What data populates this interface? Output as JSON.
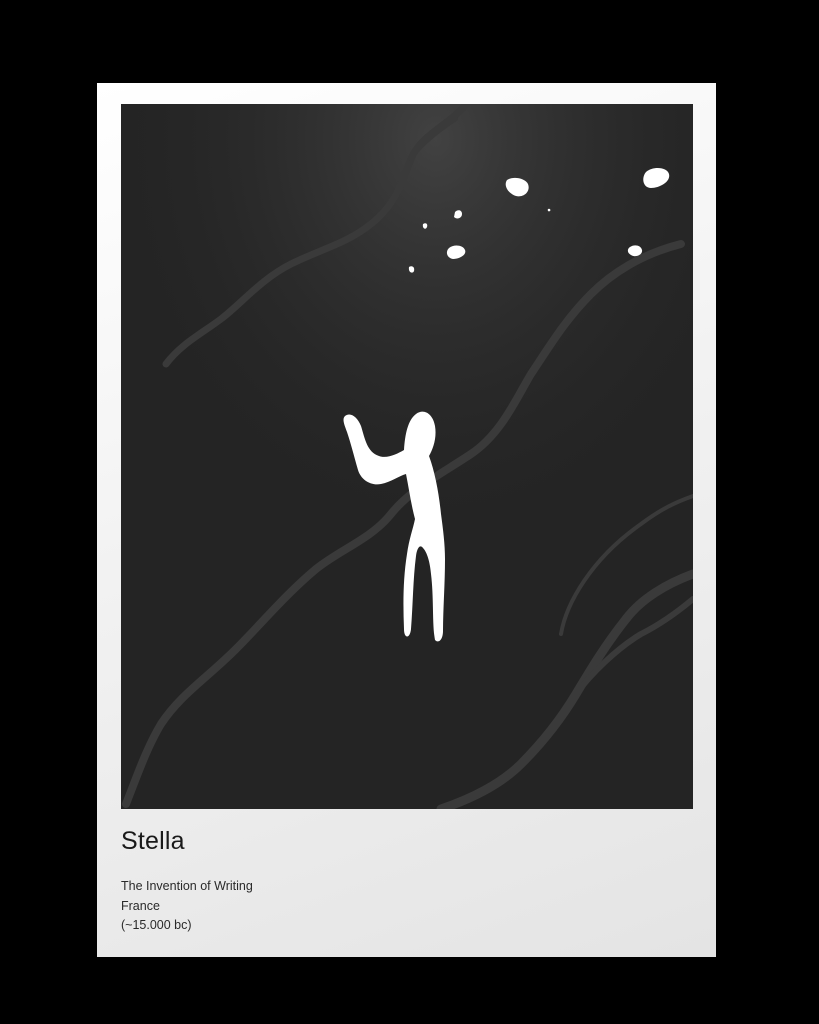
{
  "poster": {
    "title": "Stella",
    "subtitle": "The Invention of Writing",
    "location": "France",
    "date": "(~15.000 bc)"
  },
  "colors": {
    "background": "#000000",
    "paper": "#f2f2f2",
    "stone": "#242424",
    "cracks": "#3a3a3a",
    "figure": "#ffffff"
  },
  "artwork": {
    "subject": "cave-painting-human-figure",
    "stars_icon": "star-cluster-icon"
  }
}
